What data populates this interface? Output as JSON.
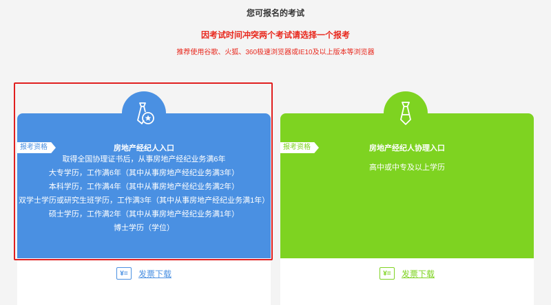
{
  "page": {
    "title": "您可报名的考试",
    "conflict_notice": "因考试时间冲突两个考试请选择一个报考",
    "browser_notice": "推荐使用谷歌、火狐、360极速浏览器或IE10及以上版本等浏览器"
  },
  "colors": {
    "blue": "#4a90e2",
    "green": "#7ed321",
    "red": "#e8271c"
  },
  "cards": [
    {
      "icon": "tie-badge-icon",
      "qualification_tag": "报考资格",
      "title": "房地产经纪人入口",
      "requirements": [
        "取得全国协理证书后，从事房地产经纪业务满6年",
        "大专学历，工作满6年（其中从事房地产经纪业务满3年）",
        "本科学历，工作满4年（其中从事房地产经纪业务满2年）",
        "双学士学历或研究生班学历，工作满3年（其中从事房地产经纪业务满1年）",
        "硕士学历，工作满2年（其中从事房地产经纪业务满1年）",
        "博士学历（学位）"
      ],
      "download_icon_text": "¥=",
      "download_label": "发票下载"
    },
    {
      "icon": "tie-icon",
      "qualification_tag": "报考资格",
      "title": "房地产经纪人协理入口",
      "requirements": [
        "高中或中专及以上学历"
      ],
      "download_icon_text": "¥=",
      "download_label": "发票下载"
    }
  ]
}
